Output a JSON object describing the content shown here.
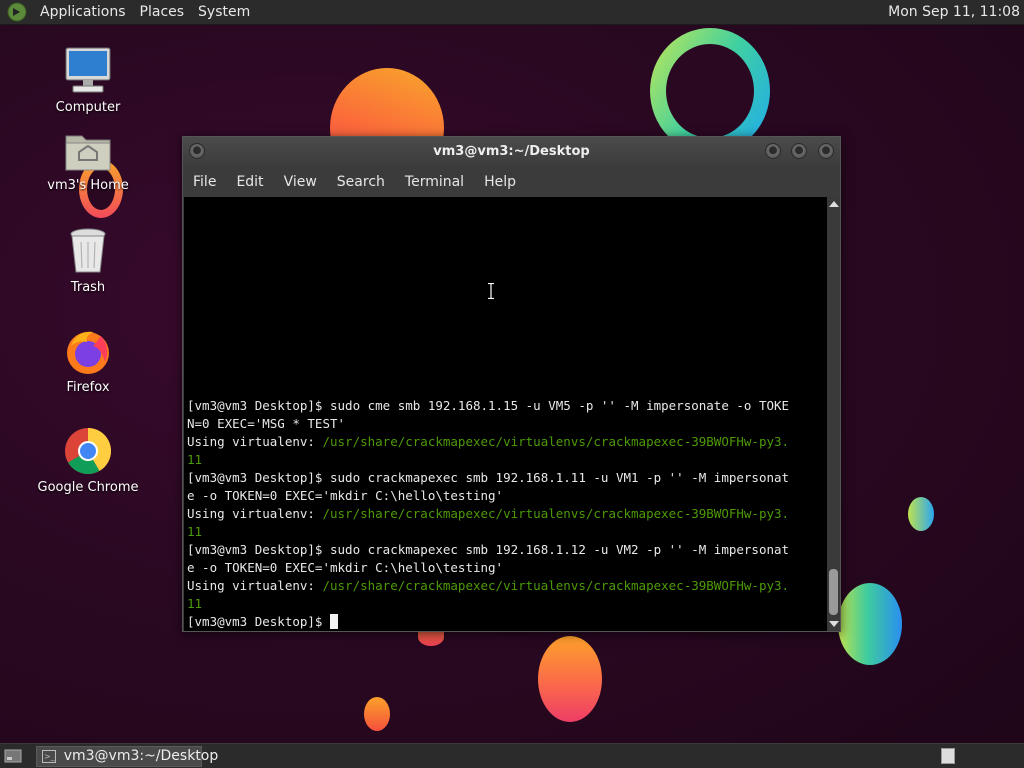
{
  "top_panel": {
    "menus": [
      "Applications",
      "Places",
      "System"
    ],
    "clock": "Mon Sep 11, 11:08"
  },
  "desktop_icons": [
    {
      "label": "Computer",
      "icon": "computer-icon"
    },
    {
      "label": "vm3's Home",
      "icon": "home-folder-icon"
    },
    {
      "label": "Trash",
      "icon": "trash-icon"
    },
    {
      "label": "Firefox",
      "icon": "firefox-icon"
    },
    {
      "label": "Google Chrome",
      "icon": "chrome-icon"
    }
  ],
  "window": {
    "title": "vm3@vm3:~/Desktop",
    "menu": [
      "File",
      "Edit",
      "View",
      "Search",
      "Terminal",
      "Help"
    ]
  },
  "terminal": {
    "lines": [
      {
        "text": "[vm3@vm3 Desktop]$ sudo cme smb 192.168.1.15 -u VM5 -p '' -M impersonate -o TOKE",
        "style": "normal"
      },
      {
        "text": "N=0 EXEC='MSG * TEST'",
        "style": "normal"
      },
      {
        "prefix": "Using virtualenv: ",
        "text": "/usr/share/crackmapexec/virtualenvs/crackmapexec-39BWOFHw-py3.",
        "style": "venv"
      },
      {
        "text": "11",
        "style": "green"
      },
      {
        "text": "[vm3@vm3 Desktop]$ sudo crackmapexec smb 192.168.1.11 -u VM1 -p '' -M impersonat",
        "style": "normal"
      },
      {
        "text": "e -o TOKEN=0 EXEC='mkdir C:\\hello\\testing'",
        "style": "normal"
      },
      {
        "prefix": "Using virtualenv: ",
        "text": "/usr/share/crackmapexec/virtualenvs/crackmapexec-39BWOFHw-py3.",
        "style": "venv"
      },
      {
        "text": "11",
        "style": "green"
      },
      {
        "text": "[vm3@vm3 Desktop]$ sudo crackmapexec smb 192.168.1.12 -u VM2 -p '' -M impersonat",
        "style": "normal"
      },
      {
        "text": "e -o TOKEN=0 EXEC='mkdir C:\\hello\\testing'",
        "style": "normal"
      },
      {
        "prefix": "Using virtualenv: ",
        "text": "/usr/share/crackmapexec/virtualenvs/crackmapexec-39BWOFHw-py3.",
        "style": "venv"
      },
      {
        "text": "11",
        "style": "green"
      }
    ],
    "prompt": "[vm3@vm3 Desktop]$ "
  },
  "taskbar": {
    "task_label": "vm3@vm3:~/Desktop"
  },
  "colors": {
    "venv_path": "#4e9a06",
    "terminal_bg": "#000000"
  }
}
